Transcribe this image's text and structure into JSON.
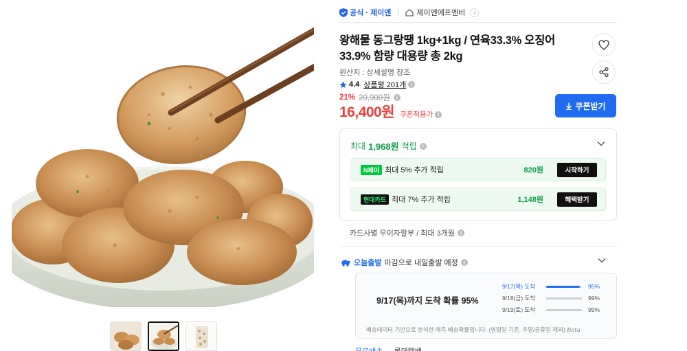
{
  "store": {
    "official_label": "공식 · 제이엔",
    "store_name": "제이엔에프엔비"
  },
  "product": {
    "title": "왕해물 동그랑땡 1kg+1kg / 연육33.3% 오징어 33.9% 함량 대용량 총 2kg",
    "origin": "원산지 : 상세설명 참조",
    "rating": "4.4",
    "review_label": "상품평 201개",
    "discount_rate": "21%",
    "original_price": "20,900원",
    "price": "16,400원",
    "coupon_note": "쿠폰적용가",
    "coupon_button": "쿠폰받기"
  },
  "points": {
    "head_prefix": "최대",
    "head_amount": "1,968원",
    "head_suffix": "적립",
    "rows": [
      {
        "tag": "N페이",
        "text": "최대 5% 추가 적립",
        "amount": "820원",
        "button": "시작하기"
      },
      {
        "tag": "현대카드",
        "text": "최대 7% 추가 적립",
        "amount": "1,148원",
        "button": "혜택받기"
      }
    ]
  },
  "installment": "카드사별 무이자할부 / 최대 3개월",
  "shipping": {
    "today_label": "오늘출발",
    "today_text": "마감으로 내일출발 예정",
    "main": "9/17(목)까지 도착 확률 95%",
    "probabilities": [
      {
        "date": "9/17(목) 도착",
        "percent": "95%",
        "value": 0.95
      },
      {
        "date": "9/18(금) 도착",
        "percent": "99%",
        "value": 0.99
      },
      {
        "date": "9/19(토) 도착",
        "percent": "99%",
        "value": 0.99
      }
    ],
    "footnote": "배송데이터 기반으로 분석한 예측 배송확률입니다. (영업일 기준, 주말/공휴일 제외)",
    "beta": "Beta"
  },
  "bottom": {
    "left": "무료배송",
    "right": "롯데택배"
  },
  "colors": {
    "price_red": "#f03c3c",
    "brand_blue": "#1f6cf0",
    "points_green": "#0e9e49",
    "naver_green": "#00c73c"
  }
}
